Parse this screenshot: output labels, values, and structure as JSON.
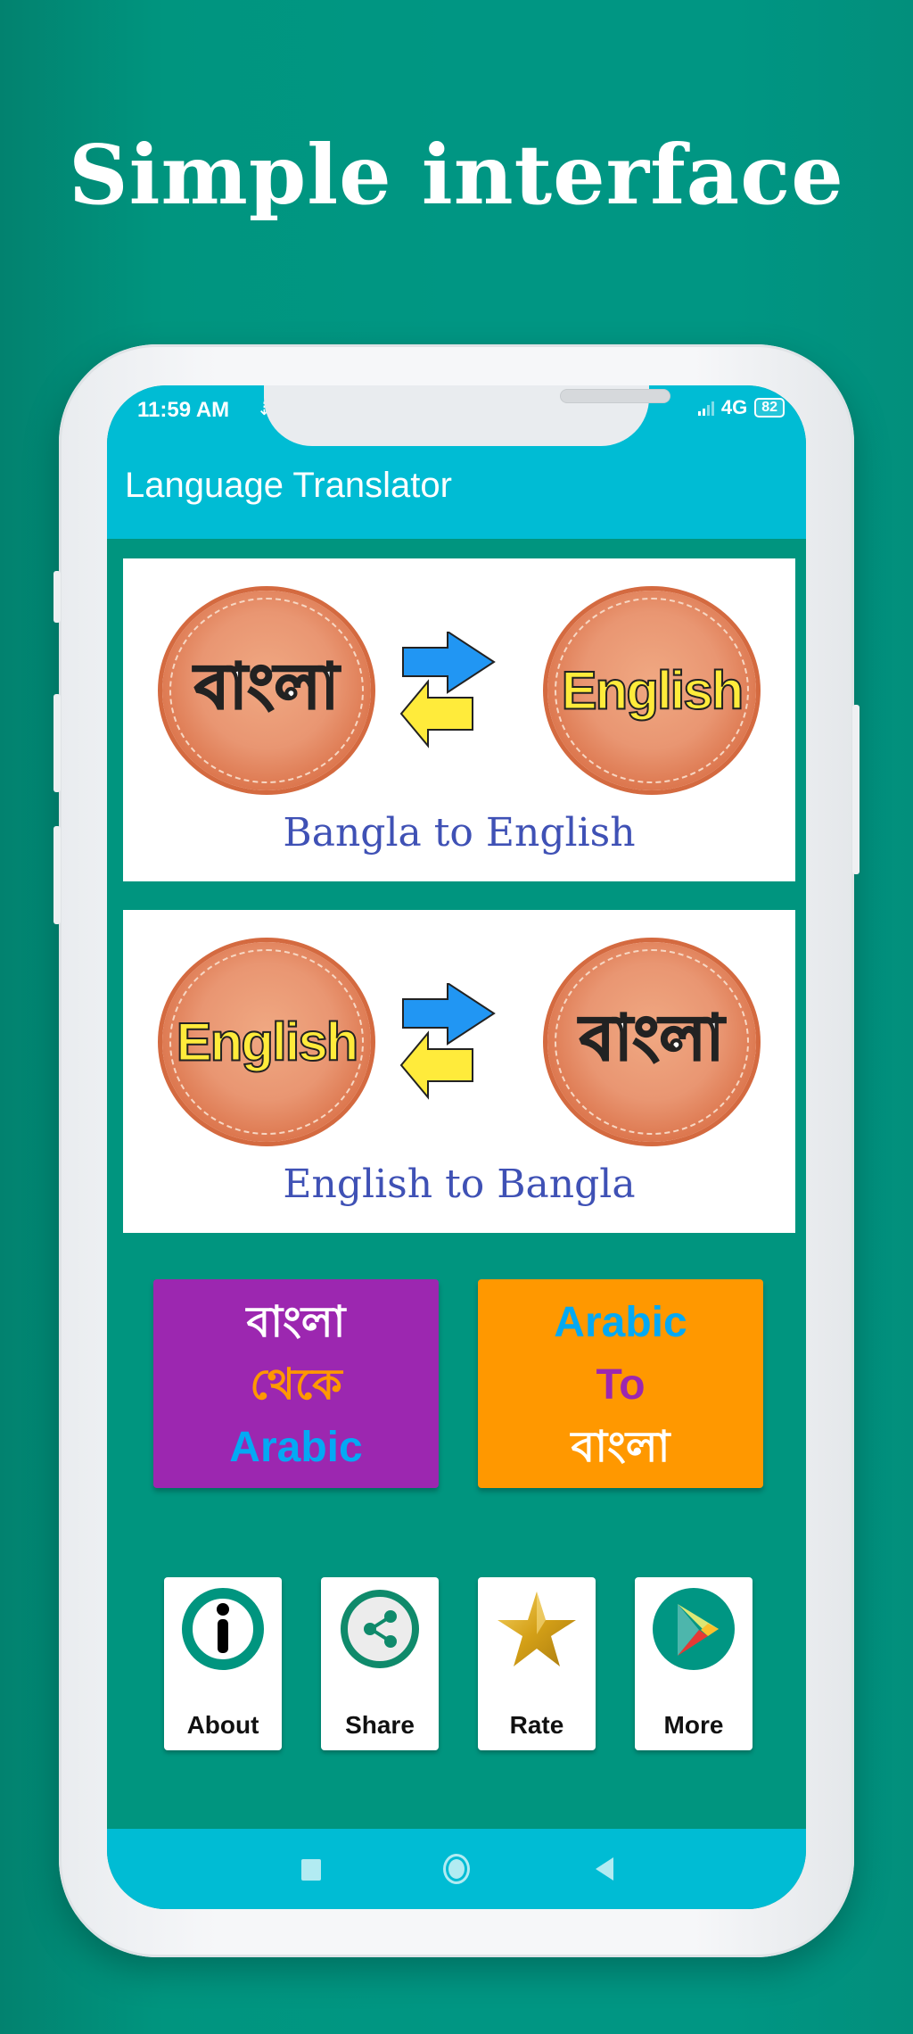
{
  "headline": "Simple interface",
  "status_bar": {
    "time": "11:59 AM",
    "download_icon": "download-icon",
    "network": "4G",
    "battery": "82"
  },
  "app_bar": {
    "title": "Language Translator"
  },
  "banners": [
    {
      "label": "Bangla to English",
      "left_badge": "বাংলা",
      "right_badge": "English"
    },
    {
      "label": "English to Bangla",
      "left_badge": "English",
      "right_badge": "বাংলা"
    }
  ],
  "tiles": [
    {
      "lines": [
        "বাংলা",
        "থেকে",
        "Arabic"
      ],
      "background": "#9c27b0",
      "line_colors": [
        "#ffffff",
        "#ff9800",
        "#03a9f4"
      ]
    },
    {
      "lines": [
        "Arabic",
        "To",
        "বাংলা"
      ],
      "background": "#ff9800",
      "line_colors": [
        "#03a9f4",
        "#9c27b0",
        "#ffffff"
      ]
    }
  ],
  "actions": [
    {
      "label": "About",
      "icon": "info-icon"
    },
    {
      "label": "Share",
      "icon": "share-icon"
    },
    {
      "label": "Rate",
      "icon": "star-icon"
    },
    {
      "label": "More",
      "icon": "play-store-icon"
    }
  ],
  "nav_bar": {
    "buttons": [
      "recents",
      "home",
      "back"
    ]
  },
  "colors": {
    "background": "#009683",
    "app_bar": "#00bcd4",
    "banner_label": "#3f51b5"
  }
}
